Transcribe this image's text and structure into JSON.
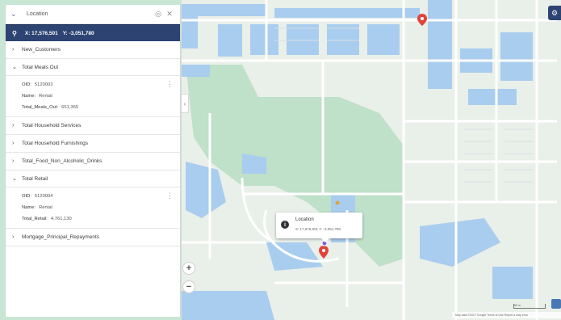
{
  "search": {
    "query": "Location"
  },
  "coordinates": {
    "x": "X: 17,576,501",
    "y": "Y: -3,051,780"
  },
  "layers": [
    {
      "label": "New_Customers",
      "expanded": false
    },
    {
      "label": "Total Meals Out",
      "expanded": true,
      "details": [
        {
          "key": "OID:",
          "value": "5120003"
        },
        {
          "key": "Name:",
          "value": "Rental"
        },
        {
          "key": "Total_Meals_Out:",
          "value": "651,365"
        }
      ]
    },
    {
      "label": "Total Household Services",
      "expanded": false
    },
    {
      "label": "Total Household Furnishings",
      "expanded": false
    },
    {
      "label": "Total_Food_Non_Alcoholic_Drinks",
      "expanded": false
    },
    {
      "label": "Total Retail",
      "expanded": true,
      "details": [
        {
          "key": "OID:",
          "value": "5120004"
        },
        {
          "key": "Name:",
          "value": "Rental"
        },
        {
          "key": "Total_Retail:",
          "value": "4,761,130"
        }
      ]
    },
    {
      "label": "Mortgage_Principal_Repayments",
      "expanded": false
    }
  ],
  "popup": {
    "title": "Location",
    "coords": "X: 17,576,501  Y: -3,051,780"
  },
  "map": {
    "attribution": "Map data ©2017 Google  Terms of Use  Report a map error",
    "scale": "50 m"
  },
  "icons": {
    "collapse": "chevron-down-icon",
    "target": "target-icon",
    "close": "close-icon",
    "pin": "map-pin-icon",
    "info": "info-icon",
    "expand": "chevron-right-icon",
    "menu": "kebab-menu-icon"
  },
  "colors": {
    "accent": "#2d4372",
    "water": "#a9cdee",
    "land": "#c3e4d3",
    "road": "#ffffff",
    "marker": "#e0443b"
  }
}
